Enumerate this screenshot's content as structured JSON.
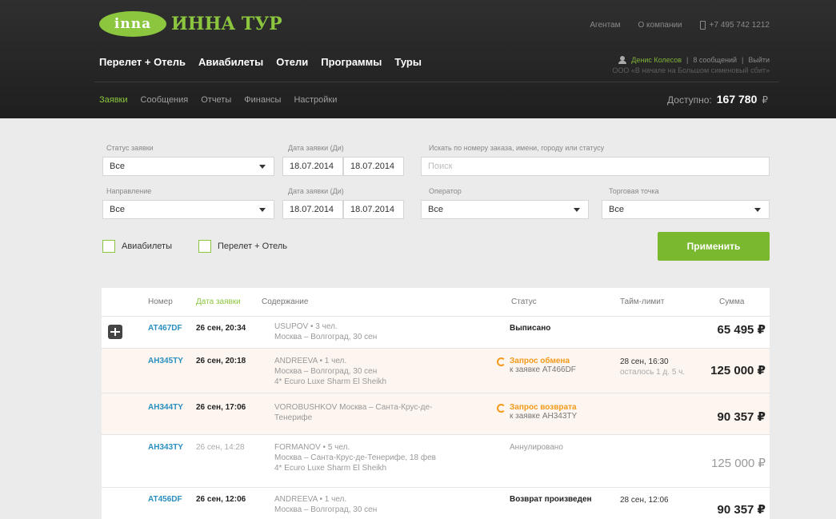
{
  "brand": {
    "logo_mark": "inna",
    "name": "ИННА ТУР"
  },
  "top_links": {
    "agencies": "Агентам",
    "about": "О компании",
    "phone": "+7 495 742 1212"
  },
  "main_nav": [
    "Перелет + Отель",
    "Авиабилеты",
    "Отели",
    "Программы",
    "Туры"
  ],
  "user": {
    "name": "Денис Колесов",
    "messages": "8 сообщений",
    "logout": "Выйти",
    "company": "ООО «В начале на Большом сименовый сбит»"
  },
  "sub_nav": {
    "items": [
      "Заявки",
      "Сообщения",
      "Отчеты",
      "Финансы",
      "Настройки"
    ],
    "active_index": 0
  },
  "balance": {
    "label": "Доступно:",
    "amount": "167 780",
    "currency": "₽"
  },
  "filters": {
    "status_label": "Статус заявки",
    "status_value": "Все",
    "date_label_1": "Дата заявки (Ди)",
    "date_from_1": "18.07.2014",
    "date_to_1": "18.07.2014",
    "search_label": "Искать по номеру заказа, имени, городу или статусу",
    "search_placeholder": "Поиск",
    "direction_label": "Направление",
    "direction_value": "Все",
    "date_label_2": "Дата заявки (Ди)",
    "date_from_2": "18.07.2014",
    "date_to_2": "18.07.2014",
    "operator_label": "Оператор",
    "operator_value": "Все",
    "point_label": "Торговая точка",
    "point_value": "Все",
    "check_avia": "Авиабилеты",
    "check_package": "Перелет + Отель",
    "apply": "Применить"
  },
  "table": {
    "headers": {
      "number": "Номер",
      "date": "Дата заявки",
      "content": "Содержание",
      "status": "Статус",
      "timelimit": "Тайм-лимит",
      "sum": "Сумма"
    },
    "rows": [
      {
        "number": "AT467DF",
        "date": "26 сен, 20:34",
        "content_1": "USUPOV • 3 чел.",
        "content_2": "Москва – Волгоград, 30 сен",
        "content_3": "",
        "status": "Выписано",
        "status_sub": "",
        "timelimit_1": "",
        "timelimit_2": "",
        "sum": "65 495 ₽"
      },
      {
        "number": "AH345TY",
        "date": "26 сен, 20:18",
        "content_1": "ANDREEVA • 1 чел.",
        "content_2": "Москва – Волгоград, 30 сен",
        "content_3": "4* Ecuro Luxe Sharm El Sheikh",
        "status": "Запрос обмена",
        "status_sub": "к заявке AT466DF",
        "timelimit_1": "28 сен, 16:30",
        "timelimit_2": "осталось 1 д. 5 ч.",
        "sum": "125 000 ₽"
      },
      {
        "number": "AH344TY",
        "date": "26 сен, 17:06",
        "content_1": "VOROBUSHKOV Москва – Санта-Крус-де-",
        "content_2": "Тенерифе",
        "content_3": "",
        "status": "Запрос возврата",
        "status_sub": "к заявке AH343TY",
        "timelimit_1": "",
        "timelimit_2": "",
        "sum": "90 357 ₽"
      },
      {
        "number": "AH343TY",
        "date": "26 сен, 14:28",
        "content_1": "FORMANOV • 5 чел.",
        "content_2": "Москва – Санта-Крус-де-Тенерифе, 18 фев",
        "content_3": "4* Ecuro Luxe Sharm El Sheikh",
        "status": "Аннулировано",
        "status_sub": "",
        "timelimit_1": "",
        "timelimit_2": "",
        "sum": "125 000 ₽"
      },
      {
        "number": "AT456DF",
        "date": "26 сен, 12:06",
        "content_1": "ANDREEVA • 1 чел.",
        "content_2": "Москва – Волгоград, 30 сен",
        "content_3": "",
        "status": "Возврат произведен",
        "status_sub": "",
        "timelimit_1": "28 сен, 12:06",
        "timelimit_2": "",
        "sum": "90 357 ₽"
      }
    ]
  },
  "colors": {
    "accent": "#8cc63f",
    "header_bg": "#262626",
    "link": "#2a8fc0",
    "warning": "#f39a1a"
  }
}
